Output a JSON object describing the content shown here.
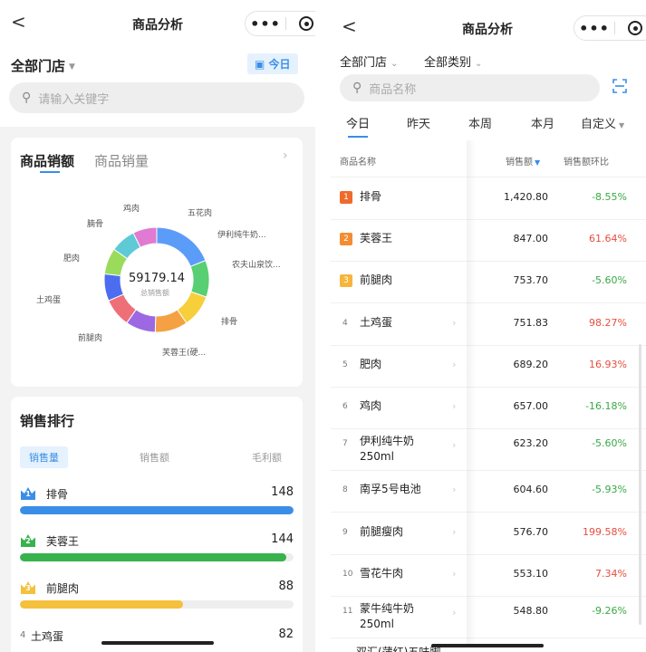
{
  "left": {
    "nav": {
      "back": "<",
      "title": "商品分析",
      "dots": "•••"
    },
    "store_filter": "全部门店",
    "today_label": "今日",
    "search_placeholder": "请输入关键字",
    "sales_card": {
      "tab_active": "商品销额",
      "tab_inactive": "商品销量",
      "center_value": "59179.14",
      "center_label": "总销售额",
      "segments": [
        {
          "label": "排骨",
          "value": 1420.8,
          "color": "#5b9cf8"
        },
        {
          "label": "芙蓉王",
          "value": 847.0,
          "color": "#58cf72"
        },
        {
          "label": "前腿肉",
          "value": 753.7,
          "color": "#f7cf3b"
        },
        {
          "label": "土鸡蛋",
          "value": 751.83,
          "color": "#f4a043"
        },
        {
          "label": "肥肉",
          "value": 689.2,
          "color": "#9c69e3"
        },
        {
          "label": "鸡肉",
          "value": 657.0,
          "color": "#ee6f77"
        },
        {
          "label": "伊利纯牛奶250ml",
          "value": 623.2,
          "color": "#4d6df0"
        },
        {
          "label": "南孚5号电池",
          "value": 604.6,
          "color": "#9bdb5b"
        },
        {
          "label": "前腿瘦肉",
          "value": 576.7,
          "color": "#5dcad6"
        },
        {
          "label": "雪花牛肉",
          "value": 553.1,
          "color": "#e07ad2"
        }
      ],
      "labels": {
        "l1": "排骨",
        "l2": "芙蓉王(硬...",
        "l3": "前腿肉",
        "l4": "土鸡蛋",
        "l5": "肥肉",
        "l6": "腩骨",
        "l7": "鸡肉",
        "l8": "五花肉",
        "l9": "伊利纯牛奶...",
        "l10": "农夫山泉饮..."
      }
    },
    "ranking": {
      "title": "销售排行",
      "seg": [
        "销售量",
        "销售额",
        "毛利额"
      ],
      "items": [
        {
          "rank": "1",
          "name": "排骨",
          "value": "148",
          "fill": 1.0,
          "color": "#3a8ee6",
          "crown": "#3a8ee6"
        },
        {
          "rank": "2",
          "name": "芙蓉王",
          "value": "144",
          "fill": 0.973,
          "color": "#37b24d",
          "crown": "#37b24d"
        },
        {
          "rank": "3",
          "name": "前腿肉",
          "value": "88",
          "fill": 0.595,
          "color": "#f5c03b",
          "crown": "#f5c03b"
        },
        {
          "rank": "4",
          "name": "土鸡蛋",
          "value": "82"
        }
      ]
    }
  },
  "right": {
    "nav": {
      "back": "<",
      "title": "商品分析",
      "dots": "•••"
    },
    "store_filter": "全部门店",
    "category_filter": "全部类别",
    "search_placeholder": "商品名称",
    "date_tabs": [
      "今日",
      "昨天",
      "本周",
      "本月",
      "自定义"
    ],
    "table": {
      "col_name": "商品名称",
      "col_sales": "销售额",
      "col_pct": "销售额环比",
      "rows": [
        {
          "rank": "1",
          "name": "排骨",
          "sales": "1,420.80",
          "pct": "-8.55%",
          "up": false,
          "badge": "#ef6a2b"
        },
        {
          "rank": "2",
          "name": "芙蓉王",
          "sales": "847.00",
          "pct": "61.64%",
          "up": true,
          "badge": "#f48c33"
        },
        {
          "rank": "3",
          "name": "前腿肉",
          "sales": "753.70",
          "pct": "-5.60%",
          "up": false,
          "badge": "#f6b53d"
        },
        {
          "rank": "4",
          "name": "土鸡蛋",
          "sales": "751.83",
          "pct": "98.27%",
          "up": true
        },
        {
          "rank": "5",
          "name": "肥肉",
          "sales": "689.20",
          "pct": "16.93%",
          "up": true
        },
        {
          "rank": "6",
          "name": "鸡肉",
          "sales": "657.00",
          "pct": "-16.18%",
          "up": false
        },
        {
          "rank": "7",
          "name": "伊利纯牛奶250ml",
          "sales": "623.20",
          "pct": "-5.60%",
          "up": false
        },
        {
          "rank": "8",
          "name": "南孚5号电池",
          "sales": "604.60",
          "pct": "-5.93%",
          "up": false
        },
        {
          "rank": "9",
          "name": "前腿瘦肉",
          "sales": "576.70",
          "pct": "199.58%",
          "up": true
        },
        {
          "rank": "10",
          "name": "雪花牛肉",
          "sales": "553.10",
          "pct": "7.34%",
          "up": true
        },
        {
          "rank": "11",
          "name": "蒙牛纯牛奶250ml",
          "sales": "548.80",
          "pct": "-9.26%",
          "up": false
        }
      ],
      "partial_row": "双汇(蒲红)五味脚"
    }
  }
}
